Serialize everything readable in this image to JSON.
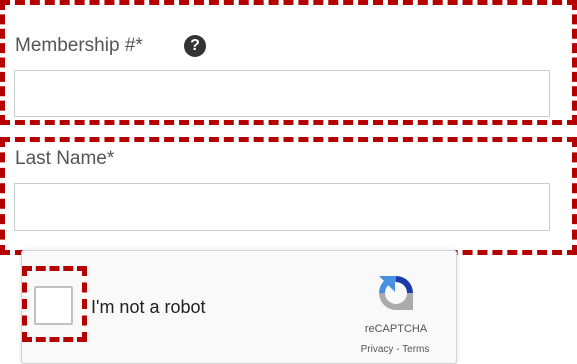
{
  "membership_field": {
    "label": "Membership #*",
    "help_glyph": "?",
    "value": "",
    "placeholder": ""
  },
  "last_name_field": {
    "label": "Last Name*",
    "value": "",
    "placeholder": ""
  },
  "recaptcha": {
    "checkbox_label": "I'm not a robot",
    "brand": "reCAPTCHA",
    "privacy_link": "Privacy",
    "separator": " - ",
    "terms_link": "Terms",
    "logo_icon": "recaptcha-logo-icon"
  },
  "colors": {
    "highlight_border": "#b50000",
    "label_text": "#555555",
    "input_border": "#cccccc",
    "recaptcha_bg": "#f9f9f9",
    "recaptcha_blue": "#1c3aa9",
    "recaptcha_light_blue": "#4a90e2",
    "recaptcha_gray": "#ababab"
  }
}
